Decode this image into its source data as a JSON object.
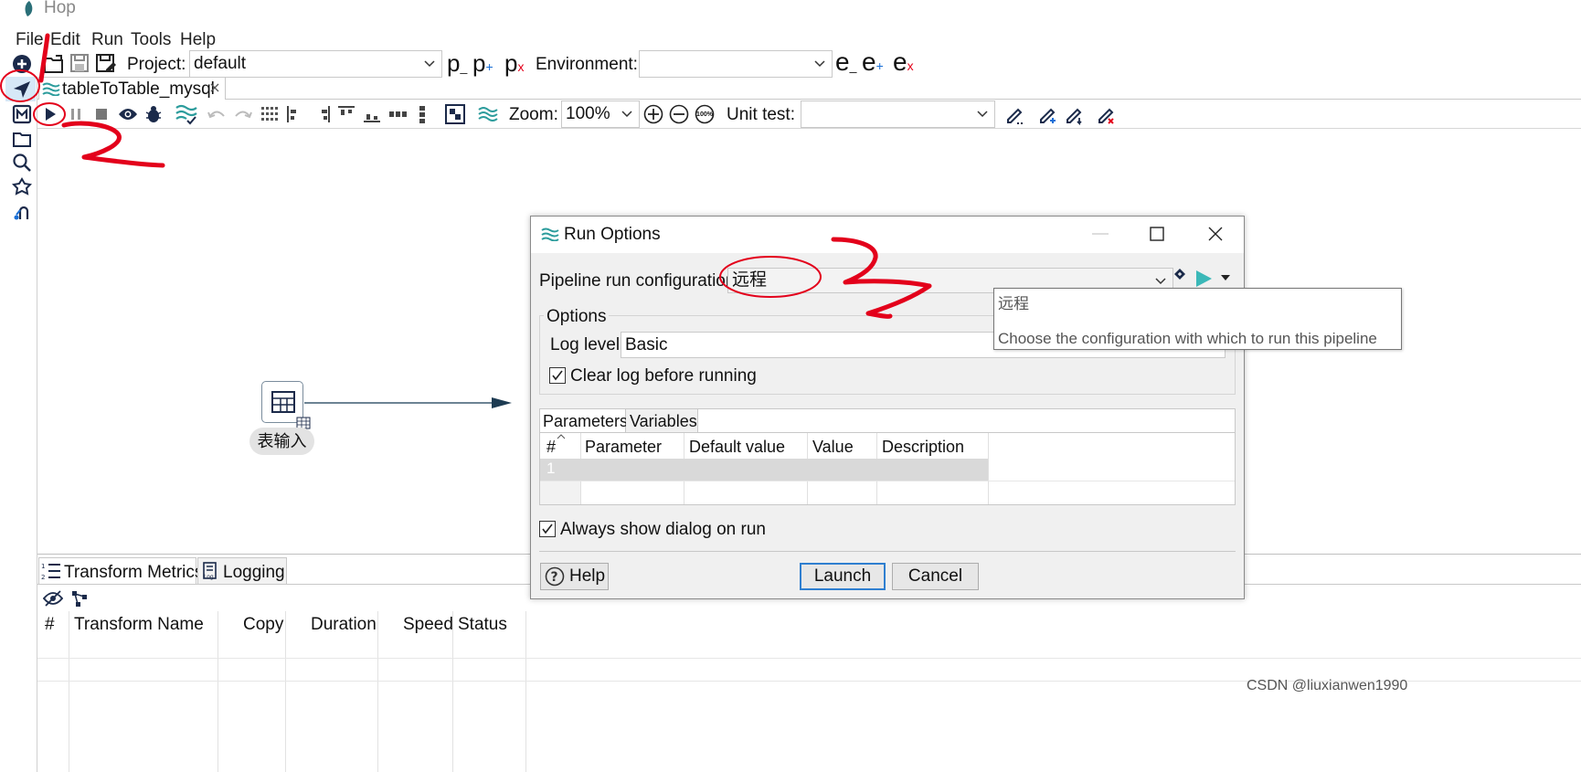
{
  "app": {
    "title": "Hop"
  },
  "menu": [
    "File",
    "Edit",
    "Run",
    "Tools",
    "Help"
  ],
  "toolbar": {
    "project_label": "Project:",
    "project_value": "default",
    "p_icons": [
      "p",
      "p",
      "p"
    ],
    "environment_label": "Environment:",
    "environment_value": "",
    "e_icons": [
      "e",
      "e",
      "e"
    ]
  },
  "tab": {
    "label": "tableToTable_mysql"
  },
  "pipeline_toolbar": {
    "zoom_label": "Zoom:",
    "zoom_value": "100%",
    "zoom_reset": "100%",
    "unit_test_label": "Unit test:",
    "unit_test_value": ""
  },
  "canvas": {
    "transform_label": "表输入"
  },
  "dialog": {
    "title": "Run Options",
    "config_label": "Pipeline run configuration",
    "config_value": "远程",
    "options_group": "Options",
    "log_level_label": "Log level:",
    "log_level_value": "Basic",
    "clear_log_label": "Clear log before running",
    "tabs": [
      "Parameters",
      "Variables"
    ],
    "columns": [
      "#",
      "Parameter",
      "Default value",
      "Value",
      "Description"
    ],
    "rows": [
      [
        "1",
        "",
        "",
        "",
        ""
      ]
    ],
    "always_show_label": "Always show dialog on run",
    "help_button": "Help",
    "launch_button": "Launch",
    "cancel_button": "Cancel"
  },
  "tooltip": {
    "title": "远程",
    "text": "Choose the configuration with which to run this pipeline"
  },
  "bottom": {
    "tabs": [
      "Transform Metrics",
      "Logging"
    ],
    "columns": [
      "#",
      "Transform Name",
      "Copy",
      "Duration",
      "Speed",
      "Status"
    ]
  },
  "watermark": "CSDN @liuxianwen1990",
  "annotations": [
    "1",
    "2",
    "3"
  ],
  "colors": {
    "accent": "#2c9c9c",
    "play_teal": "#3bb8b8",
    "red_mark": "#e3001b",
    "selected_row": "#d9d9d9"
  }
}
